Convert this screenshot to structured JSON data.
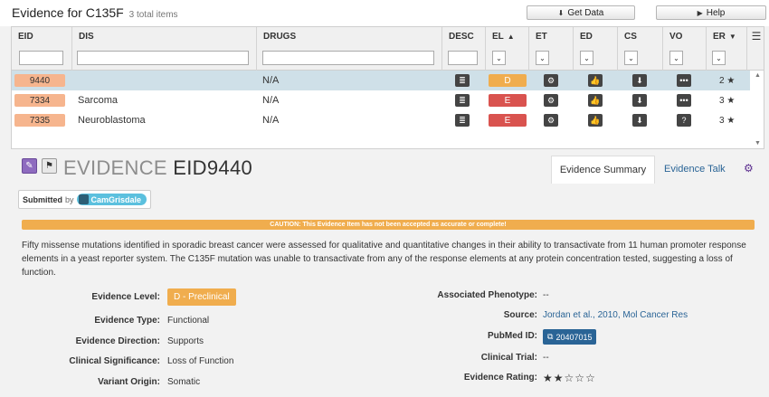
{
  "header": {
    "title": "Evidence for C135F",
    "count": "3 total items",
    "get_data_label": "Get Data",
    "help_label": "Help"
  },
  "grid": {
    "columns": [
      "EID",
      "DIS",
      "DRUGS",
      "DESC",
      "EL",
      "ET",
      "ED",
      "CS",
      "VO",
      "ER"
    ],
    "rows": [
      {
        "eid": "9440",
        "dis": "",
        "drugs": "N/A",
        "el": "D",
        "el_color": "#f0ad4e",
        "er": "2"
      },
      {
        "eid": "7334",
        "dis": "Sarcoma",
        "drugs": "N/A",
        "el": "E",
        "el_color": "#d9534f",
        "er": "3"
      },
      {
        "eid": "7335",
        "dis": "Neuroblastoma",
        "drugs": "N/A",
        "el": "E",
        "el_color": "#d9534f",
        "er": "3"
      }
    ]
  },
  "detail": {
    "heading": "EVIDENCE",
    "eid": "EID9440",
    "tabs": {
      "summary": "Evidence Summary",
      "talk": "Evidence Talk"
    },
    "submitted_label": "Submitted",
    "by_label": "by",
    "user": "CamGrisdale",
    "caution": "CAUTION: This Evidence Item has not been accepted as accurate or complete!",
    "description": "Fifty missense mutations identified in sporadic breast cancer were assessed for qualitative and quantitative changes in their ability to transactivate from 11 human promoter response elements in a yeast reporter system. The C135F mutation was unable to transactivate from any of the response elements at any protein concentration tested, suggesting a loss of function.",
    "fields": {
      "evidence_level": {
        "label": "Evidence Level:",
        "value": "D - Preclinical"
      },
      "evidence_type": {
        "label": "Evidence Type:",
        "value": "Functional"
      },
      "evidence_direction": {
        "label": "Evidence Direction:",
        "value": "Supports"
      },
      "clinical_significance": {
        "label": "Clinical Significance:",
        "value": "Loss of Function"
      },
      "variant_origin": {
        "label": "Variant Origin:",
        "value": "Somatic"
      },
      "associated_phenotype": {
        "label": "Associated Phenotype:",
        "value": "--"
      },
      "source": {
        "label": "Source:",
        "value": "Jordan et al., 2010, Mol Cancer Res"
      },
      "pubmed_id": {
        "label": "PubMed ID:",
        "value": "20407015"
      },
      "clinical_trial": {
        "label": "Clinical Trial:",
        "value": "--"
      },
      "evidence_rating": {
        "label": "Evidence Rating:",
        "value": 2,
        "max": 5
      }
    }
  },
  "colors": {
    "eid_badge": "#f6b58e",
    "level_badge": "#f0ad4e",
    "caution_bar": "#f0ad4e",
    "pubmed_badge": "#2a6496",
    "selected_row": "#cfe0e8"
  },
  "icons": [
    "download-icon",
    "play-icon",
    "menu-icon",
    "desc-icon",
    "gear-icon",
    "thumbs-up-icon",
    "circle-down-icon",
    "ellipsis-icon",
    "question-icon",
    "star-icon",
    "pencil-icon",
    "flag-icon",
    "external-link-icon"
  ]
}
